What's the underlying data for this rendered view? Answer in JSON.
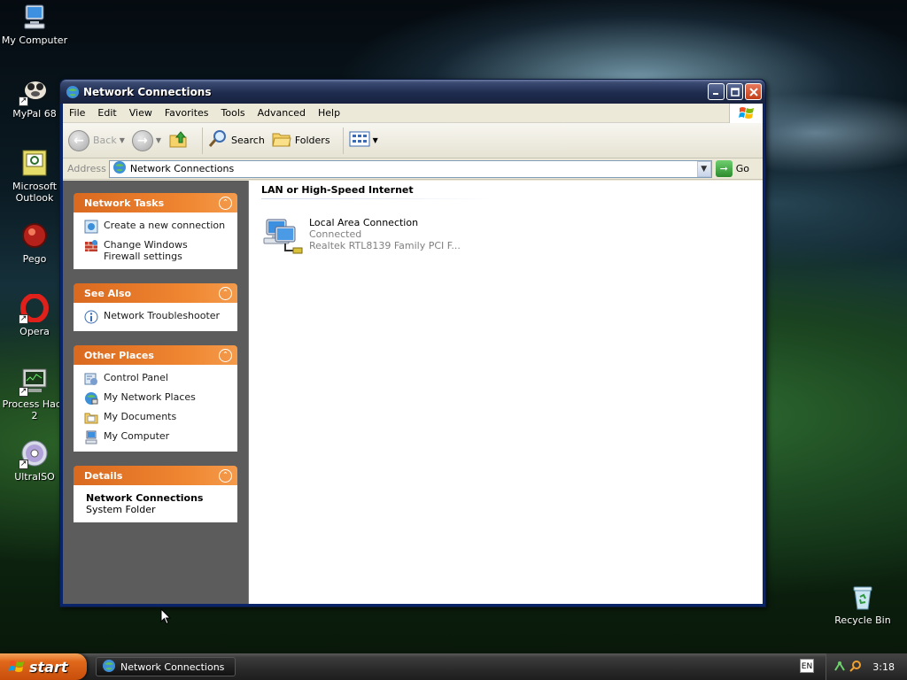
{
  "desktop": {
    "icons": [
      {
        "label": "My Computer"
      },
      {
        "label": "MyPal 68"
      },
      {
        "label": "Microsoft Outlook"
      },
      {
        "label": "Pego"
      },
      {
        "label": "Opera"
      },
      {
        "label": "Process Hack 2"
      },
      {
        "label": "UltraISO"
      },
      {
        "label": "Recycle Bin"
      }
    ]
  },
  "window": {
    "title": "Network Connections",
    "menu": [
      "File",
      "Edit",
      "View",
      "Favorites",
      "Tools",
      "Advanced",
      "Help"
    ],
    "toolbar": {
      "back": "Back",
      "search": "Search",
      "folders": "Folders"
    },
    "address": {
      "label": "Address",
      "value": "Network Connections",
      "go": "Go"
    },
    "taskpane": {
      "network_tasks": {
        "title": "Network Tasks",
        "items": [
          "Create a new connection",
          "Change Windows Firewall settings"
        ]
      },
      "see_also": {
        "title": "See Also",
        "items": [
          "Network Troubleshooter"
        ]
      },
      "other_places": {
        "title": "Other Places",
        "items": [
          "Control Panel",
          "My Network Places",
          "My Documents",
          "My Computer"
        ]
      },
      "details": {
        "title": "Details",
        "name": "Network Connections",
        "type": "System Folder"
      }
    },
    "main": {
      "group_title": "LAN or High-Speed Internet",
      "connection": {
        "name": "Local Area Connection",
        "status": "Connected",
        "device": "Realtek RTL8139 Family PCI F..."
      }
    }
  },
  "taskbar": {
    "start": "start",
    "task_button": "Network Connections",
    "language": "EN",
    "clock": "3:18"
  },
  "colors": {
    "panel_header": "#f08732",
    "taskpane_bg": "#5c5c5c",
    "titlebar": "#1f2c4f"
  }
}
